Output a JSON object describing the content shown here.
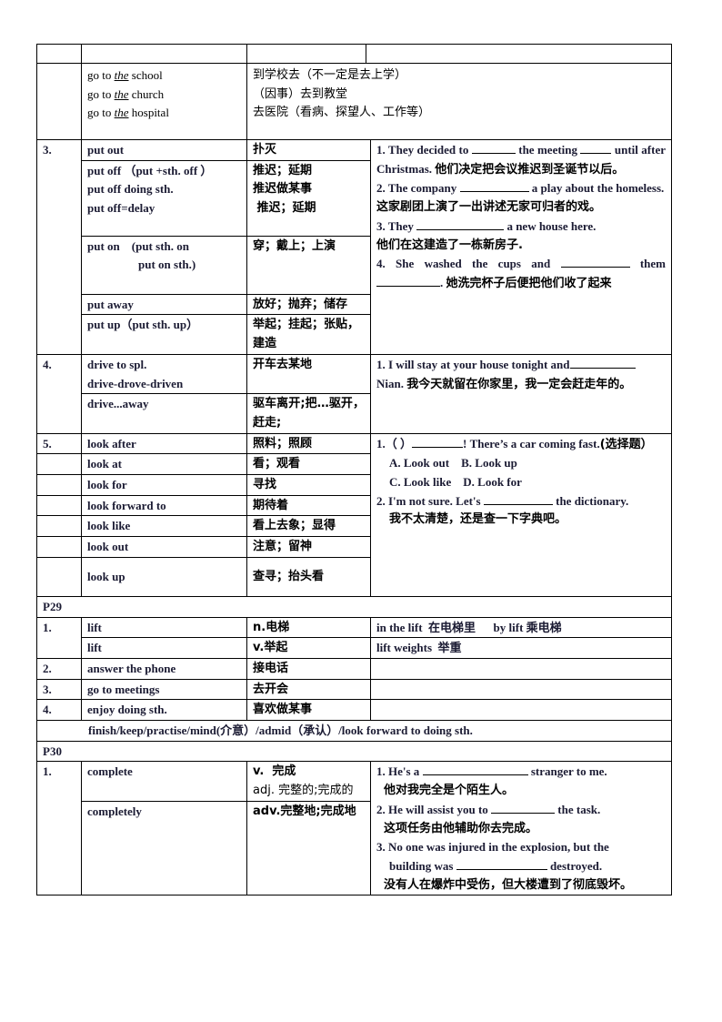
{
  "intro": {
    "rows": [
      {
        "phrase_pre": "go to ",
        "article": "the",
        "phrase_post": " school",
        "meaning": "到学校去（不一定是去上学）"
      },
      {
        "phrase_pre": "go to ",
        "article": "the",
        "phrase_post": " church",
        "meaning": "（因事）去到教堂"
      },
      {
        "phrase_pre": "go to ",
        "article": "the",
        "phrase_post": " hospital",
        "meaning": "去医院（看病、探望人、工作等）"
      }
    ]
  },
  "sec3": {
    "num": "3.",
    "put_out": {
      "phrase": "put out",
      "meaning": "扑灭"
    },
    "put_off": {
      "phrases": [
        "put off  （put +sth. off  ）",
        "put off   doing sth.",
        "put off=delay"
      ],
      "meanings": [
        "推迟；延期",
        "推迟做某事",
        " 推迟；延期"
      ]
    },
    "put_on": {
      "phrases": [
        "put on    (put sth. on",
        "put on sth.)"
      ],
      "meaning": "穿；戴上；上演"
    },
    "put_away": {
      "phrase": "put away",
      "meaning": "放好；抛弃；储存"
    },
    "put_up": {
      "phrase": "put up（put sth. up）",
      "meaning": "举起；挂起；张贴，建造"
    },
    "examples": {
      "ex1_a": "1. They decided to",
      "ex1_b": "the meeting",
      "ex1_c": "until after Christmas.",
      "ex1_zh": "他们决定把会议推迟到圣诞节以后。",
      "ex2_a": "2. The company",
      "ex2_b": "a play about the homeless.",
      "ex2_zh": "这家剧团上演了一出讲述无家可归者的戏。",
      "ex3_a": "3. They",
      "ex3_b": "a new house here.",
      "ex3_zh": "他们在这建造了一栋新房子.",
      "ex4_a": "4. She washed the cups and",
      "ex4_b": "them",
      "ex4_c": ".",
      "ex4_zh": "她洗完杯子后便把他们收了起来"
    }
  },
  "sec4": {
    "num": "4.",
    "drive_to": {
      "phrases": [
        "drive to spl.",
        "drive-drove-driven"
      ],
      "meaning": "开车去某地"
    },
    "drive_away": {
      "phrase": "drive...away",
      "meaning": "驱车离开;把…驱开，赶走;"
    },
    "example_a": "1. I will stay at your house tonight and",
    "example_b": "Nian.",
    "example_zh": "我今天就留在你家里，我一定会赶走年的。"
  },
  "sec5": {
    "num": "5.",
    "rows": [
      {
        "phrase": "look after",
        "meaning": "照料；照顾"
      },
      {
        "phrase": "look at",
        "meaning": "看；观看"
      },
      {
        "phrase": "look for",
        "meaning": "寻找"
      },
      {
        "phrase": "look forward to",
        "meaning": "期待着"
      },
      {
        "phrase": "look like",
        "meaning": "看上去象；显得"
      },
      {
        "phrase": "look out",
        "meaning": "注意；留神"
      },
      {
        "phrase": "look up",
        "meaning": "查寻；抬头看"
      }
    ],
    "ex1_a": "1.（  ）",
    "ex1_b": "! There’s a car coming fast.",
    "ex1_tag": "(选择题）",
    "opt_a": "A. Look out",
    "opt_b": "B. Look up",
    "opt_c": "C. Look like",
    "opt_d": "D. Look for",
    "ex2_a": "2. I'm not sure. Let's",
    "ex2_b": "the dictionary.",
    "ex2_zh": "我不太清楚，还是查一下字典吧。"
  },
  "p29": {
    "label": "P29",
    "rows": [
      {
        "num": "1.",
        "phrase": "lift",
        "meaning": "n.电梯",
        "note": "in the lift  在电梯里      by lift 乘电梯"
      },
      {
        "num": "",
        "phrase": "lift",
        "meaning": "v.举起",
        "note": "lift weights  举重"
      },
      {
        "num": "2.",
        "phrase": "answer the phone",
        "meaning": "接电话",
        "note": ""
      },
      {
        "num": "3.",
        "phrase": "go to meetings",
        "meaning": "去开会",
        "note": ""
      },
      {
        "num": "4.",
        "phrase": "enjoy doing sth.",
        "meaning": "喜欢做某事",
        "note": ""
      }
    ],
    "footnote": "finish/keep/practise/mind(介意）/admid（承认）/look forward to doing sth."
  },
  "p30": {
    "label": "P30",
    "num": "1.",
    "complete": {
      "phrase": "complete",
      "meanings": [
        "v.  完成",
        "adj. 完整的;完成的"
      ]
    },
    "completely": {
      "phrase": "completely",
      "meaning": "adv.完整地;完成地"
    },
    "ex1_a": "1. He's a",
    "ex1_b": "stranger to me.",
    "ex1_zh": "他对我完全是个陌生人。",
    "ex2_a": "2. He will assist you to",
    "ex2_b": "the task.",
    "ex2_zh": "这项任务由他辅助你去完成。",
    "ex3_a": "3. No one was injured in the explosion, but the",
    "ex3_b": "building was",
    "ex3_c": "destroyed.",
    "ex3_zh": "没有人在爆炸中受伤，但大楼遭到了彻底毁坏。"
  }
}
